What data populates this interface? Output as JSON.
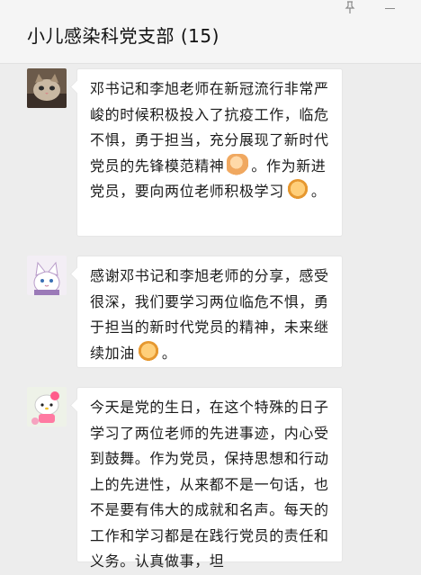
{
  "window": {
    "title": "小儿感染科党支部 (15)",
    "pin_icon": "pin-icon",
    "minimize_icon": "minimize-icon"
  },
  "messages": [
    {
      "avatar": "cat-avatar",
      "text_parts": [
        "邓书记和李旭老师在新冠流行非常严峻的时候积极投入了抗疫工作，临危不惧，勇于担当，充分展现了新时代党员的先锋模范精神",
        "。作为新进党员，要向两位老师积极学习",
        "。"
      ],
      "emojis": [
        "flexed-biceps-emoji",
        "raised-fist-emoji"
      ]
    },
    {
      "avatar": "cartoon-cat-avatar",
      "text_parts": [
        "感谢邓书记和李旭老师的分享，感受很深，我们要学习两位临危不惧，勇于担当的新时代党员的精神，未来继续加油",
        "。"
      ],
      "emojis": [
        "raised-fist-emoji"
      ]
    },
    {
      "avatar": "hello-kitty-avatar",
      "text_parts": [
        "今天是党的生日，在这个特殊的日子学习了两位老师的先进事迹，内心受到鼓舞。作为党员，保持思想和行动上的先进性，从来都不是一句话，也不是要有伟大的成就和名声。每天的工作和学习都是在践行党员的责任和义务。认真做事，坦"
      ]
    }
  ]
}
